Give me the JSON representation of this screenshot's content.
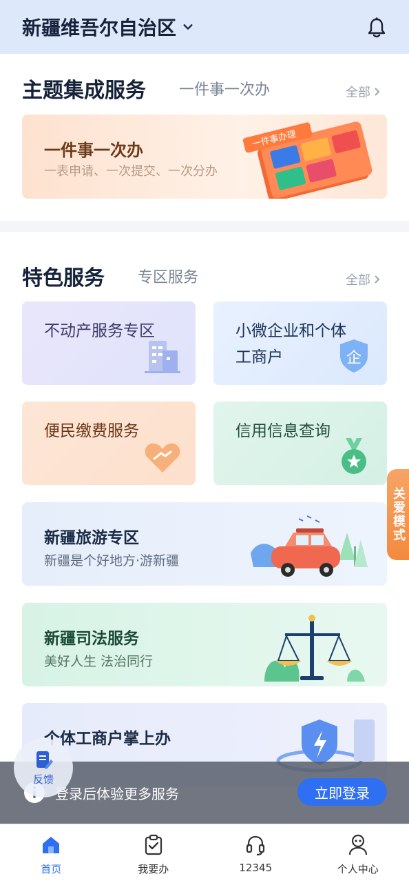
{
  "header": {
    "region": "新疆维吾尔自治区"
  },
  "theme_section": {
    "title": "主题集成服务",
    "subtitle": "一件事一次办",
    "more": "全部",
    "banner": {
      "title": "一件事一次办",
      "desc": "一表申请、一次提交、一次分办",
      "art_text": "一件事办理"
    }
  },
  "feature_section": {
    "title": "特色服务",
    "subtitle": "专区服务",
    "more": "全部",
    "cards": [
      {
        "label": "不动产服务专区",
        "icon": "building-icon"
      },
      {
        "label": "小微企业和个体工商户",
        "icon": "shield-qi-icon",
        "icon_text": "企"
      },
      {
        "label": "便民缴费服务",
        "icon": "handshake-heart-icon"
      },
      {
        "label": "信用信息查询",
        "icon": "medal-star-icon"
      }
    ],
    "banners": [
      {
        "title": "新疆旅游专区",
        "desc": "新疆是个好地方·游新疆"
      },
      {
        "title": "新疆司法服务",
        "desc": "美好人生 法治同行"
      },
      {
        "title": "个体工商户掌上办",
        "desc": ""
      }
    ]
  },
  "care_mode": {
    "label": "关爱模式"
  },
  "feedback": {
    "label": "反馈"
  },
  "login_bar": {
    "text": "登录后体验更多服务",
    "button": "立即登录"
  },
  "tabbar": {
    "items": [
      {
        "label": "首页",
        "icon": "home-icon",
        "active": true
      },
      {
        "label": "我要办",
        "icon": "clipboard-check-icon",
        "active": false
      },
      {
        "label": "12345",
        "icon": "headset-icon",
        "active": false
      },
      {
        "label": "个人中心",
        "icon": "user-icon",
        "active": false
      }
    ]
  },
  "colors": {
    "accent": "#2f6ff2",
    "care": "#f28a3e",
    "header_bg": "#dde9fb"
  }
}
